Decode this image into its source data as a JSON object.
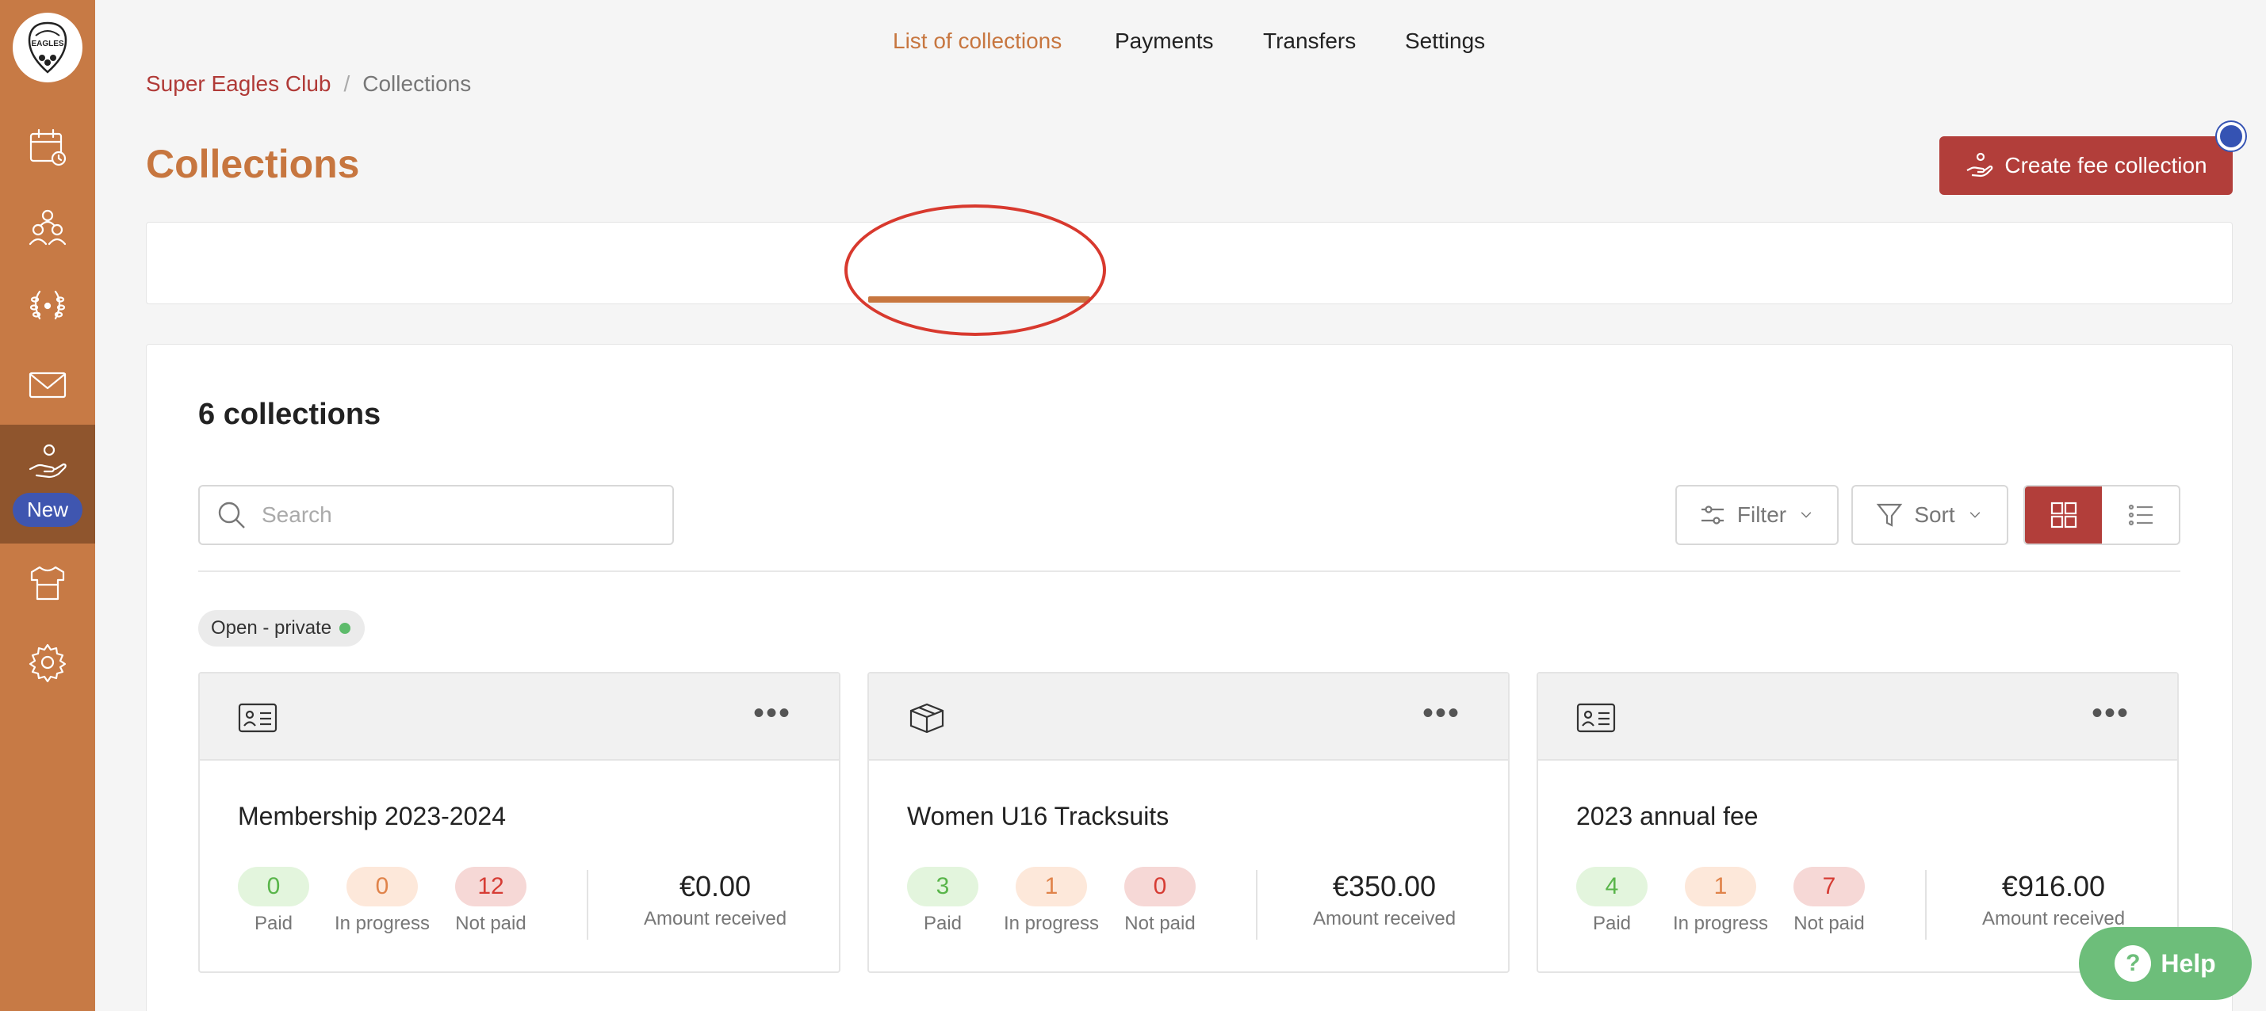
{
  "sidebar": {
    "logo_text": "EAGLES",
    "items": [
      {
        "icon": "calendar-icon"
      },
      {
        "icon": "members-icon"
      },
      {
        "icon": "laurel-icon"
      },
      {
        "icon": "mail-icon"
      },
      {
        "icon": "collections-hand-icon",
        "badge": "New"
      },
      {
        "icon": "shirt-icon"
      },
      {
        "icon": "gear-icon"
      }
    ]
  },
  "breadcrumb": {
    "club": "Super Eagles Club",
    "separator": "/",
    "current": "Collections"
  },
  "header": {
    "title": "Collections",
    "create_label": "Create fee collection"
  },
  "tabs": [
    {
      "label": "List of collections",
      "active": true
    },
    {
      "label": "Payments"
    },
    {
      "label": "Transfers"
    },
    {
      "label": "Settings"
    }
  ],
  "main": {
    "count_title": "6 collections",
    "search_placeholder": "Search",
    "filter_label": "Filter",
    "sort_label": "Sort",
    "status_chip": "Open - private",
    "labels": {
      "paid": "Paid",
      "in_progress": "In progress",
      "not_paid": "Not paid",
      "amount": "Amount received"
    },
    "cards": [
      {
        "icon": "id-card-icon",
        "title": "Membership 2023-2024",
        "paid": "0",
        "in_progress": "0",
        "not_paid": "12",
        "amount": "€0.00"
      },
      {
        "icon": "box-icon",
        "title": "Women U16 Tracksuits",
        "paid": "3",
        "in_progress": "1",
        "not_paid": "0",
        "amount": "€350.00"
      },
      {
        "icon": "id-card-icon",
        "title": "2023 annual fee",
        "paid": "4",
        "in_progress": "1",
        "not_paid": "7",
        "amount": "€916.00"
      }
    ]
  },
  "help": {
    "label": "Help"
  },
  "colors": {
    "sidebar": "#c77a45",
    "accent": "#c7763f",
    "primary_button": "#b23e3a",
    "badge": "#3f56b0",
    "help": "#6dbe7a"
  }
}
